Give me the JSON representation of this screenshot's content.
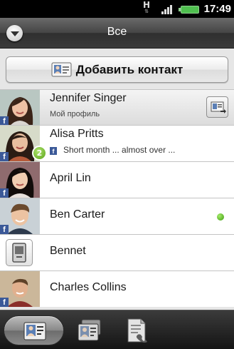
{
  "status_bar": {
    "network_type": "H",
    "time": "17:49",
    "icons": [
      "hspa-icon",
      "signal-icon",
      "battery-icon"
    ]
  },
  "header": {
    "title": "Все",
    "dropdown_icon": "chevron-down-icon"
  },
  "add_contact": {
    "label": "Добавить контакт",
    "icon": "contact-card-icon"
  },
  "contacts": [
    {
      "name": "Jennifer Singer",
      "subtitle": "Мой профиль",
      "source": "facebook",
      "action_icon": "contact-card-icon"
    },
    {
      "name": "Alisa Pritts",
      "status": "Short month ... almost over ...",
      "unread_count": "2",
      "source": "facebook"
    },
    {
      "name": "April Lin",
      "source": "facebook"
    },
    {
      "name": "Ben Carter",
      "source": "facebook",
      "online": true
    },
    {
      "name": "Bennet",
      "avatar": "placeholder-phone-icon"
    },
    {
      "name": "Charles Collins",
      "source": "facebook"
    }
  ],
  "facebook_badge": "f",
  "tabs": [
    {
      "name": "people",
      "icon": "people-icon",
      "active": true
    },
    {
      "name": "groups",
      "icon": "groups-icon",
      "active": false
    },
    {
      "name": "call-history",
      "icon": "call-history-icon",
      "active": false
    }
  ],
  "colors": {
    "facebook_blue": "#3b5998",
    "online_green": "#3d9a0f",
    "badge_green": "#5aa318"
  }
}
